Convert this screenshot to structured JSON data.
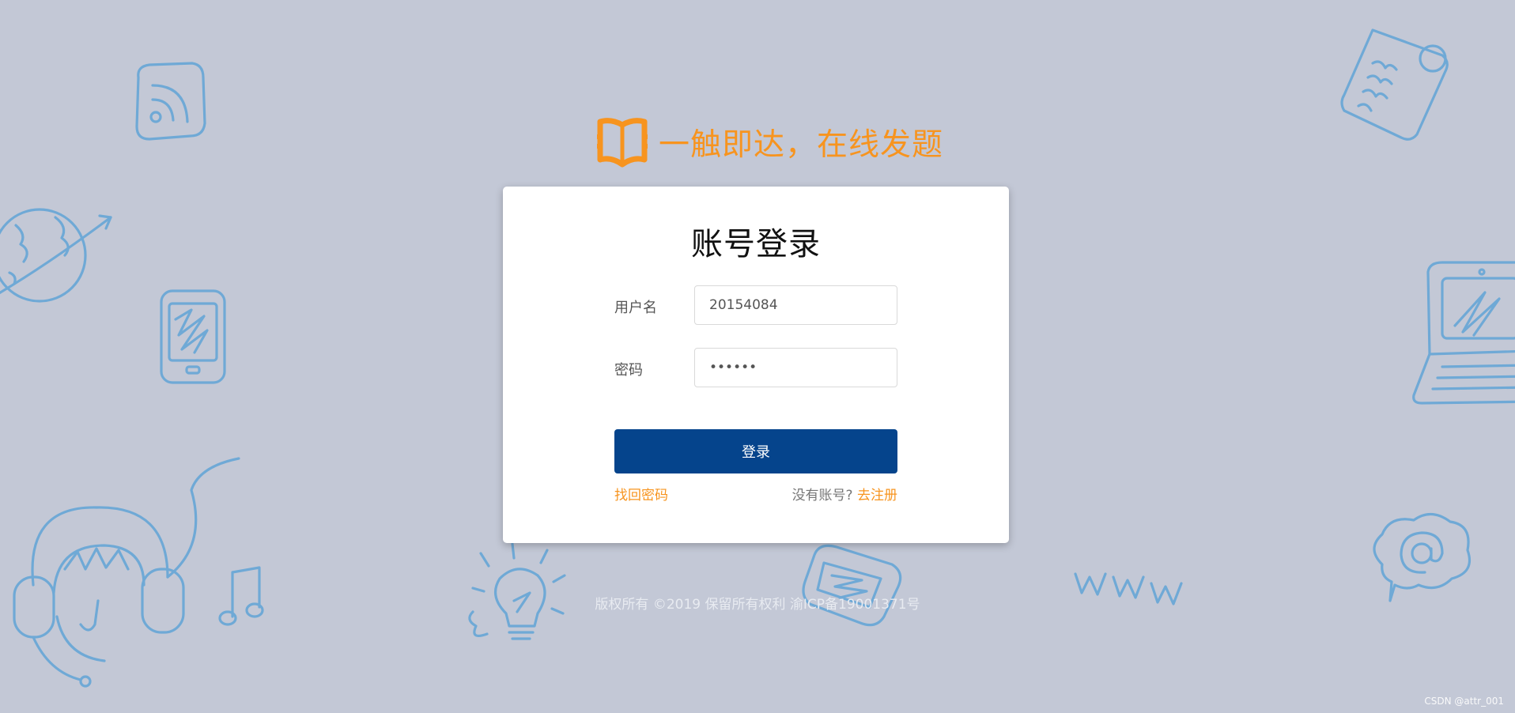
{
  "brand": {
    "logo_icon": "open-book-icon",
    "title": "一触即达，在线发题",
    "color": "#f7941f"
  },
  "login": {
    "title": "账号登录",
    "username_label": "用户名",
    "username_value": "20154084",
    "password_label": "密码",
    "password_value": "••••••",
    "submit_label": "登录",
    "forgot_password": "找回密码",
    "no_account": "没有账号? ",
    "register": "去注册",
    "button_color": "#05448c"
  },
  "footer": {
    "copyright": "版权所有 ©2019 保留所有权利 渝ICP备19001371号"
  },
  "watermark": "CSDN @attr_001",
  "background": {
    "color": "#c3c8d6",
    "doodle_color": "#6fa9d6",
    "doodles": [
      "rss-icon",
      "globe-icon",
      "smartphone-icon",
      "headphones-icon",
      "music-note-icon",
      "lightbulb-icon",
      "phone-icon",
      "www-icon",
      "document-icon",
      "laptop-icon",
      "at-sign-icon"
    ]
  }
}
